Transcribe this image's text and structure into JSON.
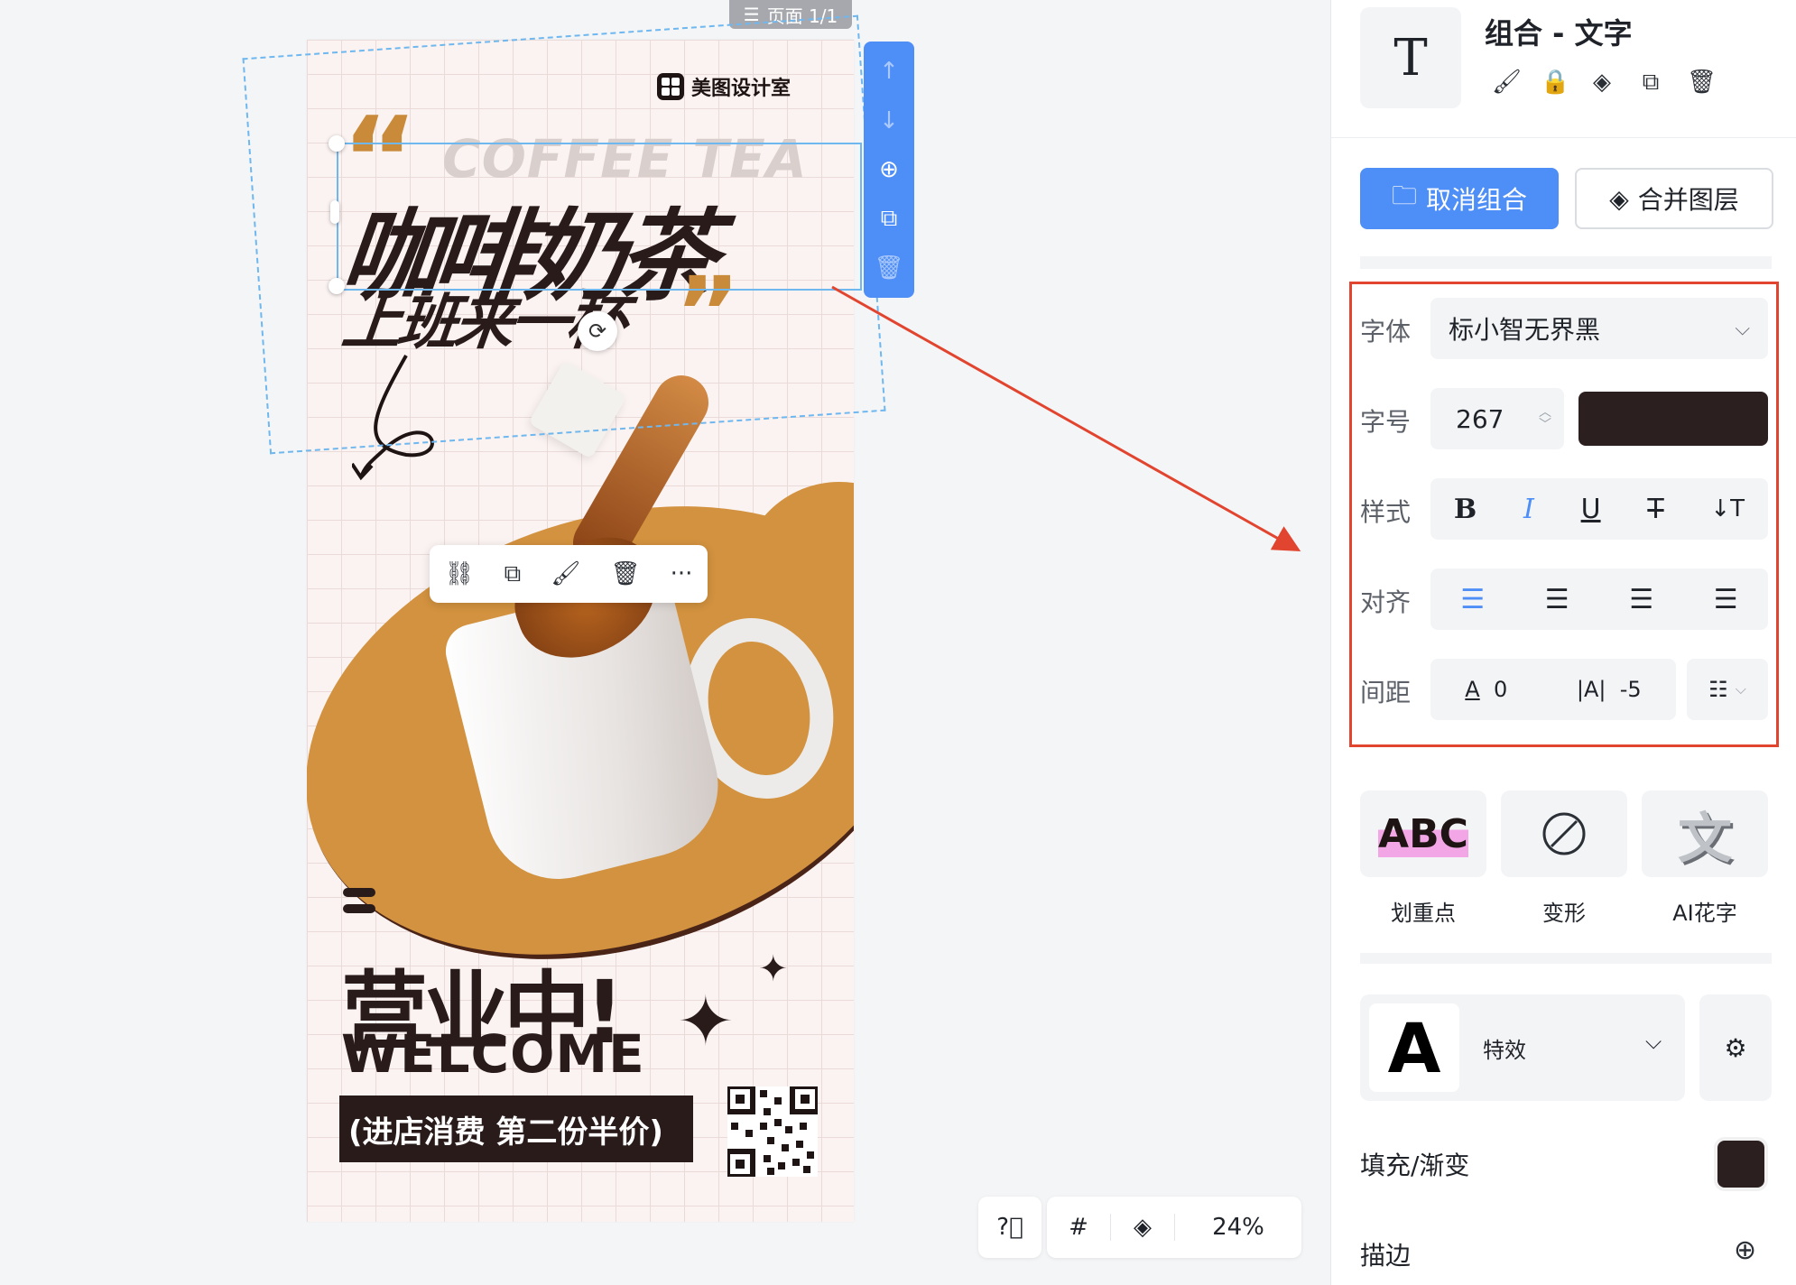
{
  "canvas": {
    "page_indicator": "页面 1/1",
    "zoom": "24%"
  },
  "poster": {
    "brand": "美图设计室",
    "coffee_tea": "COFFEE TEA",
    "title_main": "咖啡奶茶",
    "title_sub": "上班来一杯",
    "open_now": "营业中!",
    "welcome": "WELCOME",
    "promo": "(进店消费 第二份半价)"
  },
  "panel": {
    "title": "组合 - 文字",
    "ungroup_label": "取消组合",
    "merge_label": "合并图层",
    "font_label": "字体",
    "font_value": "标小智无界黑",
    "size_label": "字号",
    "size_value": "267",
    "style_label": "样式",
    "align_label": "对齐",
    "spacing_label": "间距",
    "letter_spacing": "0",
    "line_spacing": "-5",
    "text_color": "#2b1f1f",
    "fx_items": [
      {
        "label": "划重点",
        "preview": "ABC"
      },
      {
        "label": "变形"
      },
      {
        "label": "AI花字",
        "preview": "文"
      }
    ],
    "effect_label": "特效",
    "effect_preview": "A",
    "fill_label": "填充/渐变",
    "stroke_label": "描边"
  },
  "colors": {
    "accent": "#4e8ef7",
    "highlight_border": "#e2452f",
    "poster_orange": "#d2923f",
    "poster_dark": "#2a1b1b"
  }
}
